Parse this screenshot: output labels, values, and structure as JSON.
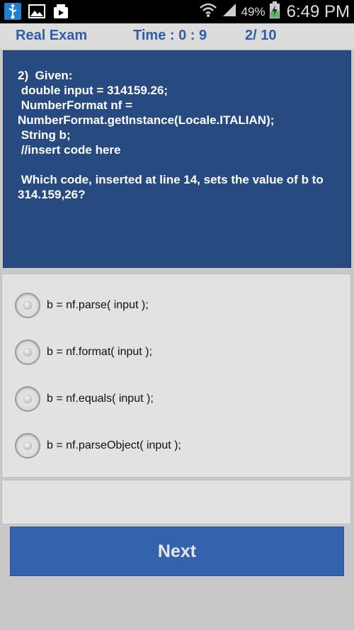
{
  "status_bar": {
    "battery_percent": "49%",
    "time": "6:49 PM",
    "icons": [
      "usb-icon",
      "image-icon",
      "gallery-icon",
      "wifi-icon",
      "signal-icon",
      "battery-charging-icon"
    ]
  },
  "header": {
    "title": "Real Exam",
    "time_label": "Time : 0 : 9",
    "progress": "2/ 10"
  },
  "question": {
    "lines": [
      "2)  Given:",
      " double input = 314159.26;",
      " NumberFormat nf =",
      "NumberFormat.getInstance(Locale.ITALIAN);",
      " String b;",
      " //insert code here",
      "",
      " Which code, inserted at line 14, sets the value of b to",
      "314.159,26?"
    ]
  },
  "options": [
    {
      "label": "b = nf.parse( input );",
      "selected": false
    },
    {
      "label": "b = nf.format( input );",
      "selected": false
    },
    {
      "label": "b = nf.equals( input );",
      "selected": false
    },
    {
      "label": "b = nf.parseObject( input );",
      "selected": false
    }
  ],
  "next_button": {
    "label": "Next"
  },
  "colors": {
    "accent": "#2f5ea6",
    "question_bg": "#274b81",
    "button_bg": "#3462ad"
  }
}
